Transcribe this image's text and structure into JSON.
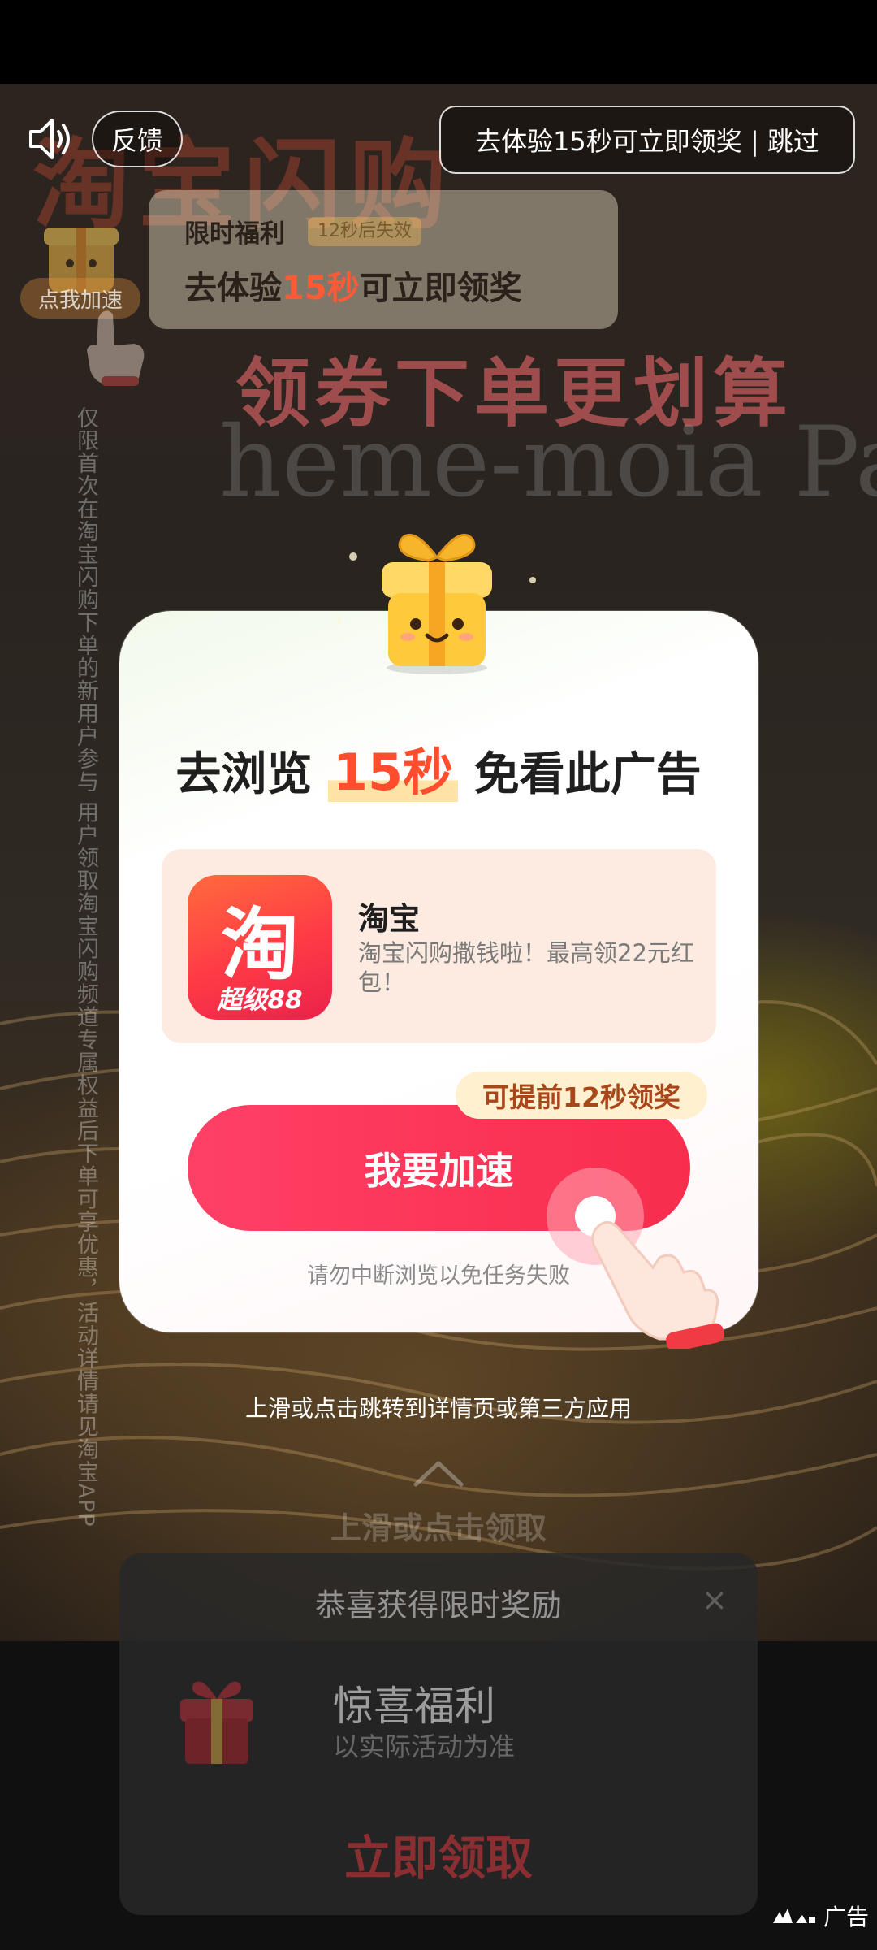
{
  "top_bar": {
    "feedback_label": "反馈",
    "skip_label": "去体验15秒可立即领奖 | 跳过"
  },
  "background": {
    "brand_text": "淘宝闪购",
    "slogan": "领券下单更划算",
    "script_text": "heme-moia Paris",
    "disclaimer": "仅限首次在淘宝闪购下单的新用户参与 用户领取淘宝闪购频道专属权益后下单可享优惠，活动详情请见淘宝APP"
  },
  "welfare_banner": {
    "mini_button": "点我加速",
    "title": "限时福利",
    "timer": "12秒后失效",
    "main_prefix": "去体验",
    "main_seconds": "15秒",
    "main_suffix": "可立即领奖"
  },
  "modal": {
    "title_prefix": "去浏览",
    "title_seconds": "15秒",
    "title_suffix": "免看此广告",
    "app": {
      "name": "淘宝",
      "description": "淘宝闪购撒钱啦！最高领22元红包！",
      "icon_char": "淘",
      "icon_badge": "超级88"
    },
    "speed_tag": "可提前12秒领奖",
    "speed_button": "我要加速",
    "warning": "请勿中断浏览以免任务失败"
  },
  "jump_hint": "上滑或点击跳转到详情页或第三方应用",
  "swipe_hint": "上滑或点击领取",
  "reward_card": {
    "title": "恭喜获得限时奖励",
    "close": "×",
    "name": "惊喜福利",
    "subtitle": "以实际活动为准",
    "button": "立即领取"
  },
  "ad_label": "广告",
  "colors": {
    "accent_red": "#f82d4d",
    "highlight_orange": "#ff4d2e",
    "tag_bg": "#fff0cf",
    "card_bg": "#fdeae0"
  }
}
